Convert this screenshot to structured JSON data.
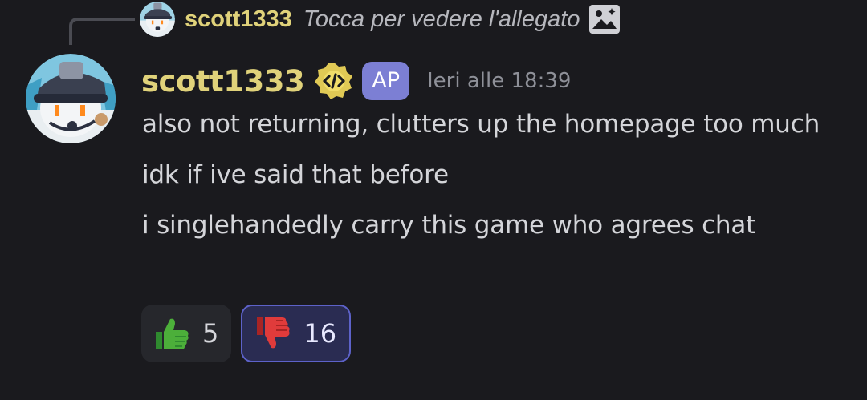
{
  "reply": {
    "author": "scott1333",
    "text": "Tocca per vedere l'allegato",
    "attachment_icon": "image-icon"
  },
  "message": {
    "author": "scott1333",
    "author_color": "#e0d27a",
    "badge_icon": "developer-badge-icon",
    "tag": "AP",
    "tag_color": "#7c7fd4",
    "timestamp": "Ieri alle 18:39",
    "lines": [
      "also not returning, clutters up the homepage too much",
      "idk if ive said that before",
      "i singlehandedly carry this game who agrees chat"
    ]
  },
  "reactions": [
    {
      "emoji": "thumbs-up-icon",
      "count": "5",
      "selected": false
    },
    {
      "emoji": "thumbs-down-icon",
      "count": "16",
      "selected": true
    }
  ]
}
